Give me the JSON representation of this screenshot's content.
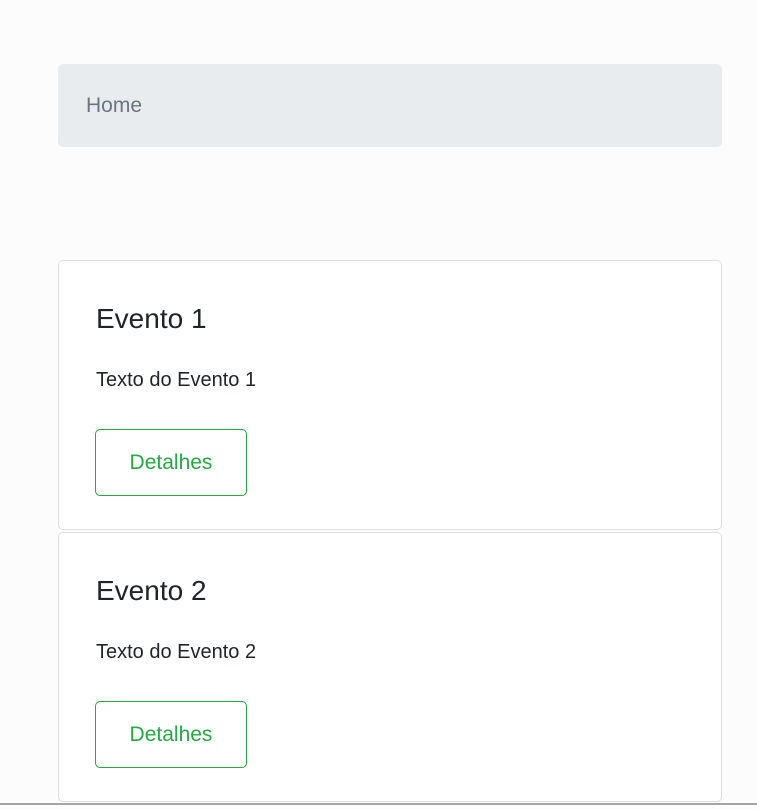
{
  "breadcrumb": {
    "items": [
      {
        "label": "Home"
      }
    ]
  },
  "events": [
    {
      "title": "Evento 1",
      "text": "Texto do Evento 1",
      "button_label": "Detalhes"
    },
    {
      "title": "Evento 2",
      "text": "Texto do Evento 2",
      "button_label": "Detalhes"
    }
  ],
  "colors": {
    "success": "#28a745",
    "breadcrumb_bg": "#e9ecef",
    "muted_text": "#6c757d"
  }
}
